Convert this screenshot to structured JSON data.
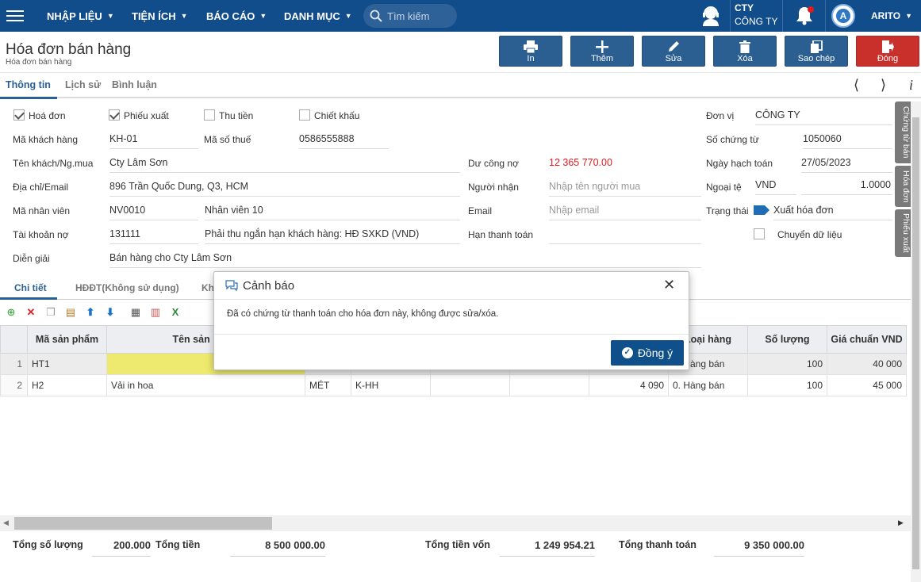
{
  "nav": {
    "menu": [
      "NHẬP LIỆU",
      "TIỆN ÍCH",
      "BÁO CÁO",
      "DANH MỤC"
    ],
    "search_placeholder": "Tìm kiếm",
    "company_short": "CTY",
    "company_name": "CÔNG TY",
    "user": "ARITO"
  },
  "page": {
    "title": "Hóa đơn bán hàng",
    "breadcrumb": "Hóa đơn bán hàng"
  },
  "toolbar": {
    "print": "In",
    "add": "Thêm",
    "edit": "Sửa",
    "delete": "Xóa",
    "copy": "Sao chép",
    "close": "Đóng"
  },
  "tabs": [
    "Thông tin",
    "Lịch sử",
    "Bình luận"
  ],
  "form": {
    "chk_invoice": "Hoá đơn",
    "chk_export": "Phiếu xuất",
    "chk_receipt": "Thu tiền",
    "chk_discount": "Chiết khấu",
    "customer_code_label": "Mã khách hàng",
    "customer_code": "KH-01",
    "tax_code_label": "Mã số thuế",
    "tax_code": "0586555888",
    "customer_name_label": "Tên khách/Ng.mua",
    "customer_name": "Cty Lâm Sơn",
    "address_label": "Địa chỉ/Email",
    "address": "896 Trần Quốc Dung, Q3, HCM",
    "staff_label": "Mã nhân viên",
    "staff_code": "NV0010",
    "staff_name": "Nhân viên 10",
    "debit_label": "Tài khoản nợ",
    "debit_account": "131111",
    "debit_desc": "Phải thu ngắn hạn khách hàng: HĐ SXKD (VND)",
    "note_label": "Diễn giải",
    "note": "Bán hàng cho Cty Lâm Sơn",
    "balance_label": "Dư công nợ",
    "balance": "12 365 770.00",
    "receiver_label": "Người nhận",
    "receiver_placeholder": "Nhập tên người mua",
    "email_label": "Email",
    "email_placeholder": "Nhập email",
    "due_label": "Hạn thanh toán",
    "unit_label": "Đơn vị",
    "unit": "CÔNG TY",
    "doc_no_label": "Số chứng từ",
    "doc_no": "1050060",
    "posting_date_label": "Ngày hạch toán",
    "posting_date": "27/05/2023",
    "currency_label": "Ngoại tệ",
    "currency": "VND",
    "rate": "1.0000",
    "status_label": "Trạng thái",
    "status": "Xuất hóa đơn",
    "transfer_label": "Chuyển dữ liệu"
  },
  "side_tabs": [
    "Chứng từ bán",
    "Hóa đơn",
    "Phiếu xuất"
  ],
  "detail_tabs": [
    "Chi tiết",
    "HĐĐT(Không sử dụng)",
    "Khá"
  ],
  "grid": {
    "headers": [
      "",
      "Mã sản phẩm",
      "Tên sản phẩm",
      "",
      "",
      "",
      "",
      "",
      "Loại hàng",
      "Số lượng",
      "Giá chuẩn VND"
    ],
    "rows": [
      {
        "idx": "1",
        "code": "HT1",
        "name": "",
        "unit": "",
        "c4": "",
        "c5": "",
        "c6": "",
        "c7": "",
        "type": "0. Hàng bán",
        "qty": "100",
        "price": "40 000"
      },
      {
        "idx": "2",
        "code": "H2",
        "name": "Vải in hoa",
        "unit": "MÉT",
        "c4": "K-HH",
        "c5": "",
        "c6": "",
        "c7": "4 090",
        "type": "0. Hàng bán",
        "qty": "100",
        "price": "45 000"
      }
    ]
  },
  "totals": {
    "qty_label": "Tổng số lượng",
    "qty": "200.000",
    "amount_label": "Tổng tiền",
    "amount": "8 500 000.00",
    "cost_label": "Tổng tiền vốn",
    "cost": "1 249 954.21",
    "pay_label": "Tổng thanh toán",
    "pay": "9 350 000.00"
  },
  "dialog": {
    "title": "Cảnh báo",
    "message": "Đã có chứng từ thanh toán cho hóa đơn này, không được sửa/xóa.",
    "ok": "Đồng ý"
  },
  "colors": {
    "nav_bg": "#114d8a",
    "button_blue": "#2b5f92",
    "button_red": "#c9302c",
    "balance_red": "#e0191f",
    "highlight_yellow": "#eeea6f"
  }
}
